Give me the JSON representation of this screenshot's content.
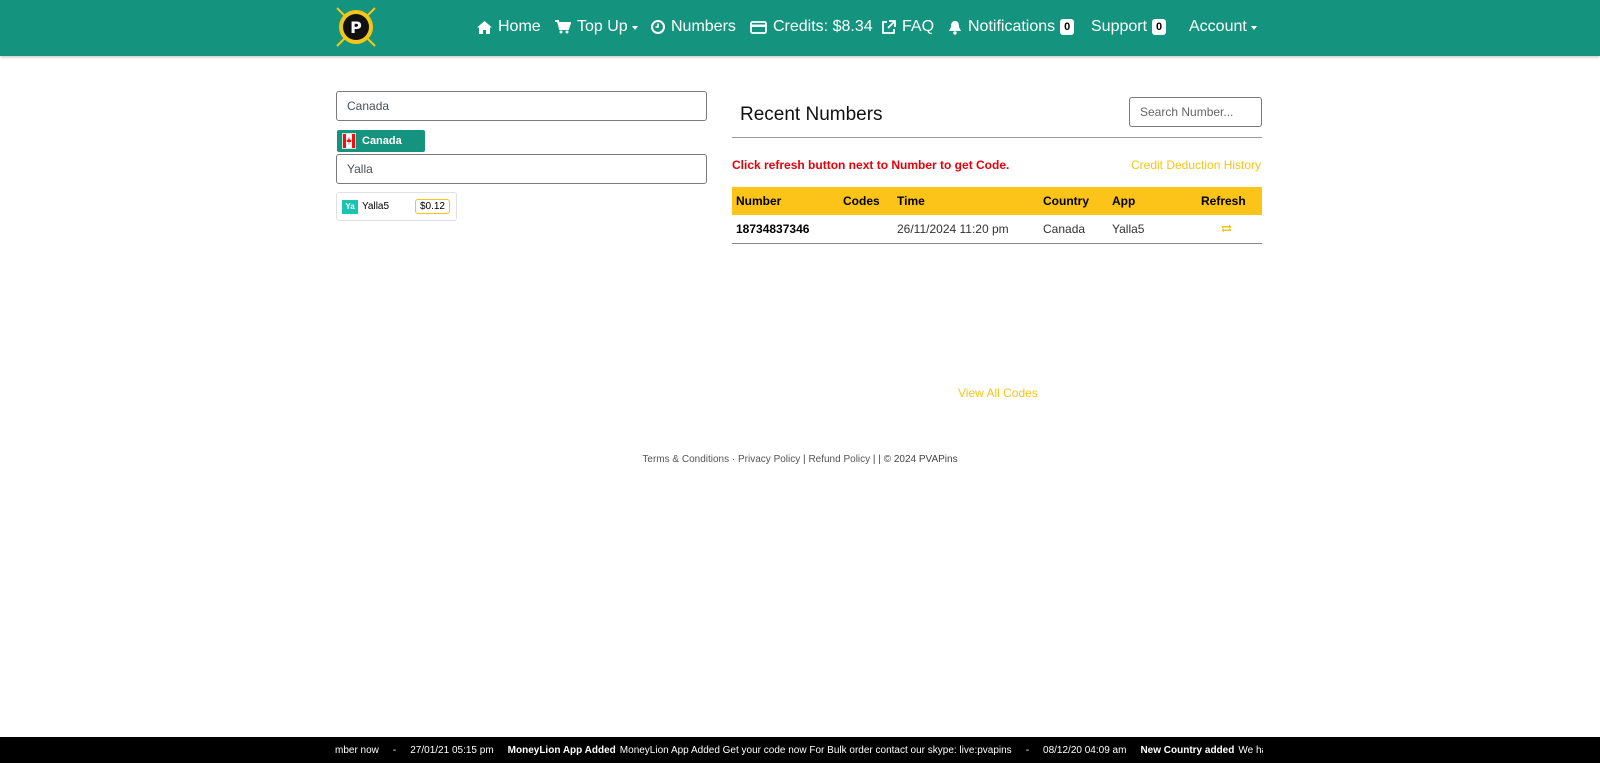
{
  "nav": {
    "home": "Home",
    "top_up": "Top Up",
    "numbers": "Numbers",
    "credits": "Credits: $8.34",
    "faq": "FAQ",
    "notifications": "Notifications",
    "notifications_count": "0",
    "support": "Support",
    "support_count": "0",
    "account": "Account"
  },
  "left": {
    "country_input": "Canada",
    "country_chip": "Canada",
    "app_input": "Yalla",
    "app_card": {
      "logo_text": "Ya",
      "name": "Yalla5",
      "price": "$0.12"
    }
  },
  "recent": {
    "title": "Recent Numbers",
    "search_placeholder": "Search Number...",
    "notice": "Click refresh button next to Number to get Code.",
    "credit_history": "Credit Deduction History",
    "columns": [
      "Number",
      "Codes",
      "Time",
      "Country",
      "App",
      "Refresh"
    ],
    "rows": [
      {
        "number": "18734837346",
        "codes": "",
        "time": "26/11/2024 11:20 pm",
        "country": "Canada",
        "app": "Yalla5"
      }
    ],
    "view_all": "View All Codes"
  },
  "footer": {
    "terms": "Terms & Conditions",
    "dot": "·",
    "privacy": "Privacy Policy",
    "sep1": "|",
    "refund": "Refund Policy",
    "sep2": "| |",
    "copyright": "© 2024 PVAPins"
  },
  "ticker": [
    "mber now",
    "-",
    "27/01/21 05:15 pm",
    "MoneyLion App Added",
    "MoneyLion App Added Get your code now For Bulk order contact our skype: live:pvapins",
    "-",
    "08/12/20 04:09 am",
    "New Country added",
    "We have a"
  ],
  "colors": {
    "brand": "#14947e",
    "accent": "#fcc419",
    "notice": "#e6000a"
  }
}
